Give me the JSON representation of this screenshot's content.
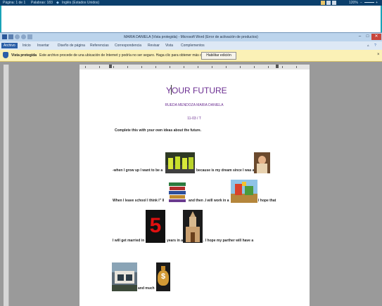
{
  "taskbar": {
    "page_info": "Página: 1 de 1",
    "words": "Palabras: 183",
    "language": "Inglés (Estados Unidos)",
    "zoom": "120%"
  },
  "window": {
    "title": "MARIA DANIELA (Vista protegida) - Microsoft Word (Error de activación de productos)"
  },
  "ribbon": {
    "tabs": [
      "Archivo",
      "Inicio",
      "Insertar",
      "Diseño de página",
      "Referencias",
      "Correspondencia",
      "Revisar",
      "Vista",
      "Complementos"
    ]
  },
  "protected_view": {
    "label": "Vista protegida",
    "message": "Este archivo procede de una ubicación de Internet y podría no ser seguro. Haga clic para obtener más detalles.",
    "button": "Habilitar edición"
  },
  "document": {
    "title": "YOUR   FUTURE",
    "author": "RUEDA MENDOZA MARIA DANIELA",
    "date": "11-03 / T",
    "instructions": "Complete this  with  your own ideas about  the future.",
    "line1_a": "-when I grow up I want to be a",
    "line1_b": "because is my dream since I was a",
    "line2_a": "When I leave school I think I\" ll",
    "line2_b": "and then .I will work in a",
    "line2_c": "I hope that",
    "line3_a": "I will get married in",
    "line3_number": "5",
    "line3_b": "years in a",
    "line3_c": ". I hope my parther will have a",
    "line4_a": "and much",
    "moneybag_symbol": "$"
  },
  "colors": {
    "title_purple": "#6b2d91",
    "protected_bar": "#fbf1b6",
    "file_tab": "#2a5fa8",
    "number_red": "#e01010"
  }
}
